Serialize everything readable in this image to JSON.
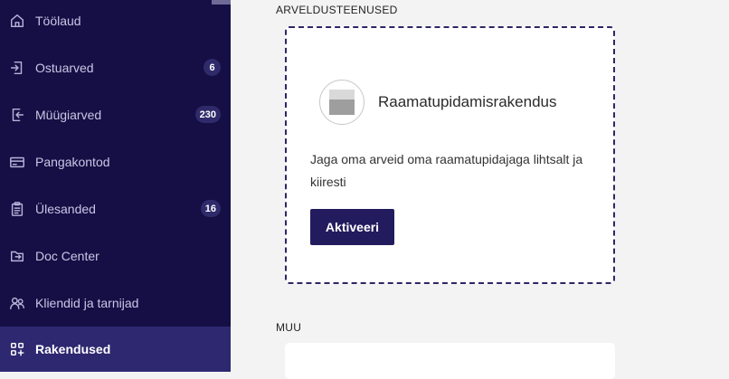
{
  "sidebar": {
    "items": [
      {
        "label": "Töölaud",
        "icon": "home-icon"
      },
      {
        "label": "Ostuarved",
        "icon": "invoice-in-icon",
        "badge": "6"
      },
      {
        "label": "Müügiarved",
        "icon": "invoice-out-icon",
        "badge": "230"
      },
      {
        "label": "Pangakontod",
        "icon": "bank-card-icon"
      },
      {
        "label": "Ülesanded",
        "icon": "clipboard-icon",
        "badge": "16"
      },
      {
        "label": "Doc Center",
        "icon": "doc-center-icon"
      },
      {
        "label": "Kliendid ja tarnijad",
        "icon": "contacts-icon"
      },
      {
        "label": "Rakendused",
        "icon": "apps-icon",
        "active": true
      }
    ]
  },
  "main": {
    "section1_title": "ARVELDUSTEENUSED",
    "app_card": {
      "name": "Raamatupidamisrakendus",
      "description": "Jaga oma arveid oma raamatupidajaga lihtsalt ja kiiresti",
      "button_label": "Aktiveeri"
    },
    "section2_title": "MUU"
  },
  "colors": {
    "sidebar_bg": "#150f45",
    "sidebar_active": "#2e2870",
    "accent": "#221c5e",
    "page_bg": "#f3f3f4"
  }
}
